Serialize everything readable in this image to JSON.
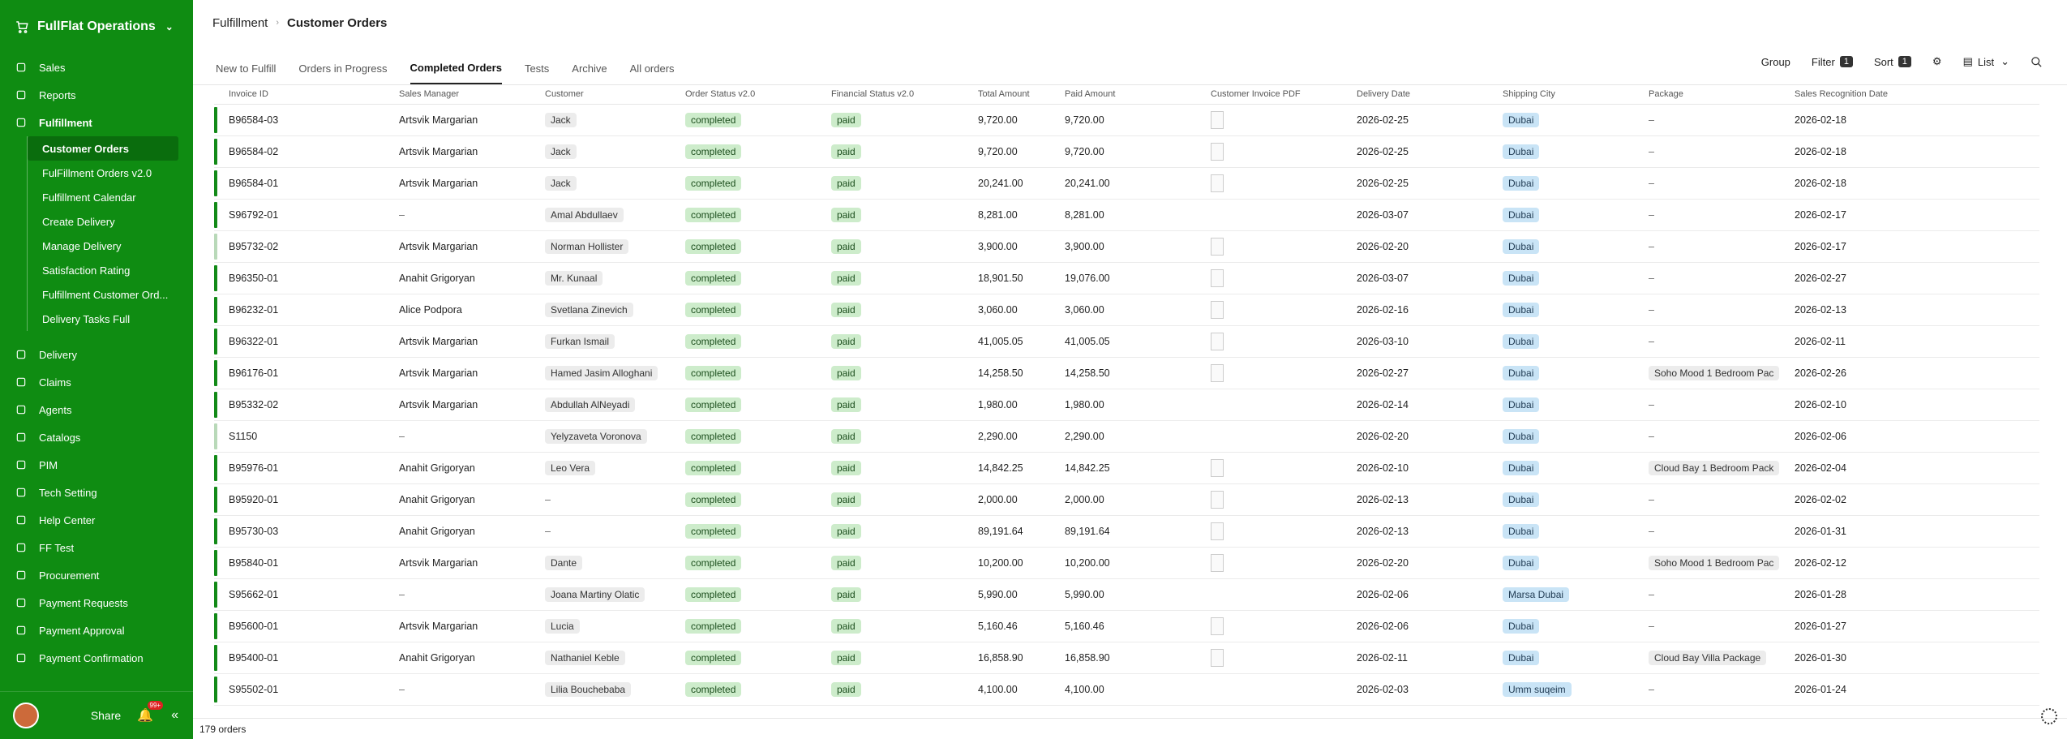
{
  "app": {
    "name": "FullFlat Operations"
  },
  "sidebar": {
    "items": [
      {
        "label": "Sales",
        "icon": "cart-icon"
      },
      {
        "label": "Reports",
        "icon": "chart-icon"
      },
      {
        "label": "Fulfillment",
        "icon": "circle-icon",
        "bold": true
      },
      {
        "label": "Delivery",
        "icon": "truck-icon"
      },
      {
        "label": "Claims",
        "icon": "claim-icon"
      },
      {
        "label": "Agents",
        "icon": "users-icon"
      },
      {
        "label": "Catalogs",
        "icon": "catalog-icon"
      },
      {
        "label": "PIM",
        "icon": "pim-icon"
      },
      {
        "label": "Tech Setting",
        "icon": "settings-icon"
      },
      {
        "label": "Help Center",
        "icon": "help-icon"
      },
      {
        "label": "FF Test",
        "icon": "test-icon"
      },
      {
        "label": "Procurement",
        "icon": "procurement-icon"
      },
      {
        "label": "Payment Requests",
        "icon": "payment-icon"
      },
      {
        "label": "Payment Approval",
        "icon": "approval-icon"
      },
      {
        "label": "Payment Confirmation",
        "icon": "confirm-icon"
      }
    ],
    "fulfillment_sub": [
      {
        "label": "Customer Orders",
        "active": true
      },
      {
        "label": "FulFillment Orders v2.0"
      },
      {
        "label": "Fulfillment Calendar"
      },
      {
        "label": "Create Delivery"
      },
      {
        "label": "Manage Delivery"
      },
      {
        "label": "Satisfaction Rating"
      },
      {
        "label": "Fulfillment Customer Ord..."
      },
      {
        "label": "Delivery Tasks Full"
      }
    ],
    "bottom": {
      "share": "Share",
      "badge": "99+"
    }
  },
  "breadcrumb": {
    "parent": "Fulfillment",
    "current": "Customer Orders"
  },
  "tabs": [
    "New to Fulfill",
    "Orders in Progress",
    "Completed Orders",
    "Tests",
    "Archive",
    "All orders"
  ],
  "toolbar": {
    "group": "Group",
    "filter": "Filter",
    "filter_count": "1",
    "sort": "Sort",
    "sort_count": "1",
    "view": "List"
  },
  "table": {
    "columns": [
      "Invoice ID",
      "Sales Manager",
      "Customer",
      "Order Status v2.0",
      "Financial Status v2.0",
      "Total Amount",
      "Paid Amount",
      "Customer Invoice PDF",
      "Delivery Date",
      "Shipping City",
      "Package",
      "Sales Recognition Date"
    ],
    "rows": [
      {
        "inv": "B96584-03",
        "mgr": "Artsvik Margarian",
        "cust": "Jack",
        "ord": "completed",
        "fin": "paid",
        "tot": "9,720.00",
        "paid": "9,720.00",
        "pdf": true,
        "del": "2026-02-25",
        "city": "Dubai",
        "pkg": "–",
        "srd": "2026-02-18",
        "bar": "dark"
      },
      {
        "inv": "B96584-02",
        "mgr": "Artsvik Margarian",
        "cust": "Jack",
        "ord": "completed",
        "fin": "paid",
        "tot": "9,720.00",
        "paid": "9,720.00",
        "pdf": true,
        "del": "2026-02-25",
        "city": "Dubai",
        "pkg": "–",
        "srd": "2026-02-18",
        "bar": "dark"
      },
      {
        "inv": "B96584-01",
        "mgr": "Artsvik Margarian",
        "cust": "Jack",
        "ord": "completed",
        "fin": "paid",
        "tot": "20,241.00",
        "paid": "20,241.00",
        "pdf": true,
        "del": "2026-02-25",
        "city": "Dubai",
        "pkg": "–",
        "srd": "2026-02-18",
        "bar": "dark"
      },
      {
        "inv": "S96792-01",
        "mgr": "–",
        "cust": "Amal Abdullaev",
        "ord": "completed",
        "fin": "paid",
        "tot": "8,281.00",
        "paid": "8,281.00",
        "pdf": false,
        "del": "2026-03-07",
        "city": "Dubai",
        "pkg": "–",
        "srd": "2026-02-17",
        "bar": "dark"
      },
      {
        "inv": "B95732-02",
        "mgr": "Artsvik Margarian",
        "cust": "Norman Hollister",
        "ord": "completed",
        "fin": "paid",
        "tot": "3,900.00",
        "paid": "3,900.00",
        "pdf": true,
        "del": "2026-02-20",
        "city": "Dubai",
        "pkg": "–",
        "srd": "2026-02-17",
        "bar": "light"
      },
      {
        "inv": "B96350-01",
        "mgr": "Anahit Grigoryan",
        "cust": "Mr. Kunaal",
        "ord": "completed",
        "fin": "paid",
        "tot": "18,901.50",
        "paid": "19,076.00",
        "pdf": true,
        "del": "2026-03-07",
        "city": "Dubai",
        "pkg": "–",
        "srd": "2026-02-27",
        "bar": "dark"
      },
      {
        "inv": "B96232-01",
        "mgr": "Alice Podpora",
        "cust": "Svetlana Zinevich",
        "ord": "completed",
        "fin": "paid",
        "tot": "3,060.00",
        "paid": "3,060.00",
        "pdf": true,
        "del": "2026-02-16",
        "city": "Dubai",
        "pkg": "–",
        "srd": "2026-02-13",
        "bar": "dark"
      },
      {
        "inv": "B96322-01",
        "mgr": "Artsvik Margarian",
        "cust": "Furkan Ismail",
        "ord": "completed",
        "fin": "paid",
        "tot": "41,005.05",
        "paid": "41,005.05",
        "pdf": true,
        "del": "2026-03-10",
        "city": "Dubai",
        "pkg": "–",
        "srd": "2026-02-11",
        "bar": "dark"
      },
      {
        "inv": "B96176-01",
        "mgr": "Artsvik Margarian",
        "cust": "Hamed Jasim Alloghani",
        "ord": "completed",
        "fin": "paid",
        "tot": "14,258.50",
        "paid": "14,258.50",
        "pdf": true,
        "del": "2026-02-27",
        "city": "Dubai",
        "pkg": "Soho Mood 1 Bedroom Pac",
        "srd": "2026-02-26",
        "bar": "dark"
      },
      {
        "inv": "B95332-02",
        "mgr": "Artsvik Margarian",
        "cust": "Abdullah AlNeyadi",
        "ord": "completed",
        "fin": "paid",
        "tot": "1,980.00",
        "paid": "1,980.00",
        "pdf": false,
        "del": "2026-02-14",
        "city": "Dubai",
        "pkg": "–",
        "srd": "2026-02-10",
        "bar": "dark"
      },
      {
        "inv": "S1150",
        "mgr": "–",
        "cust": "Yelyzaveta Voronova",
        "ord": "completed",
        "fin": "paid",
        "tot": "2,290.00",
        "paid": "2,290.00",
        "pdf": false,
        "del": "2026-02-20",
        "city": "Dubai",
        "pkg": "–",
        "srd": "2026-02-06",
        "bar": "light"
      },
      {
        "inv": "B95976-01",
        "mgr": "Anahit Grigoryan",
        "cust": "Leo Vera",
        "ord": "completed",
        "fin": "paid",
        "tot": "14,842.25",
        "paid": "14,842.25",
        "pdf": true,
        "del": "2026-02-10",
        "city": "Dubai",
        "pkg": "Cloud Bay 1 Bedroom Pack",
        "srd": "2026-02-04",
        "bar": "dark"
      },
      {
        "inv": "B95920-01",
        "mgr": "Anahit Grigoryan",
        "cust": "",
        "ord": "completed",
        "fin": "paid",
        "tot": "2,000.00",
        "paid": "2,000.00",
        "pdf": true,
        "del": "2026-02-13",
        "city": "Dubai",
        "pkg": "–",
        "srd": "2026-02-02",
        "bar": "dark"
      },
      {
        "inv": "B95730-03",
        "mgr": "Anahit Grigoryan",
        "cust": "",
        "ord": "completed",
        "fin": "paid",
        "tot": "89,191.64",
        "paid": "89,191.64",
        "pdf": true,
        "del": "2026-02-13",
        "city": "Dubai",
        "pkg": "–",
        "srd": "2026-01-31",
        "bar": "dark"
      },
      {
        "inv": "B95840-01",
        "mgr": "Artsvik Margarian",
        "cust": "Dante",
        "ord": "completed",
        "fin": "paid",
        "tot": "10,200.00",
        "paid": "10,200.00",
        "pdf": true,
        "del": "2026-02-20",
        "city": "Dubai",
        "pkg": "Soho Mood 1 Bedroom Pac",
        "srd": "2026-02-12",
        "bar": "dark"
      },
      {
        "inv": "S95662-01",
        "mgr": "–",
        "cust": "Joana Martiny Olatic",
        "ord": "completed",
        "fin": "paid",
        "tot": "5,990.00",
        "paid": "5,990.00",
        "pdf": false,
        "del": "2026-02-06",
        "city": "Marsa Dubai",
        "pkg": "–",
        "srd": "2026-01-28",
        "bar": "dark"
      },
      {
        "inv": "B95600-01",
        "mgr": "Artsvik Margarian",
        "cust": "Lucia",
        "ord": "completed",
        "fin": "paid",
        "tot": "5,160.46",
        "paid": "5,160.46",
        "pdf": true,
        "del": "2026-02-06",
        "city": "Dubai",
        "pkg": "–",
        "srd": "2026-01-27",
        "bar": "dark"
      },
      {
        "inv": "B95400-01",
        "mgr": "Anahit Grigoryan",
        "cust": "Nathaniel Keble",
        "ord": "completed",
        "fin": "paid",
        "tot": "16,858.90",
        "paid": "16,858.90",
        "pdf": true,
        "del": "2026-02-11",
        "city": "Dubai",
        "pkg": "Cloud Bay Villa Package",
        "srd": "2026-01-30",
        "bar": "dark"
      },
      {
        "inv": "S95502-01",
        "mgr": "–",
        "cust": "Lilia Bouchebaba",
        "ord": "completed",
        "fin": "paid",
        "tot": "4,100.00",
        "paid": "4,100.00",
        "pdf": false,
        "del": "2026-02-03",
        "city": "Umm suqeim",
        "pkg": "–",
        "srd": "2026-01-24",
        "bar": "dark"
      }
    ]
  },
  "footer": {
    "count": "179 orders"
  }
}
